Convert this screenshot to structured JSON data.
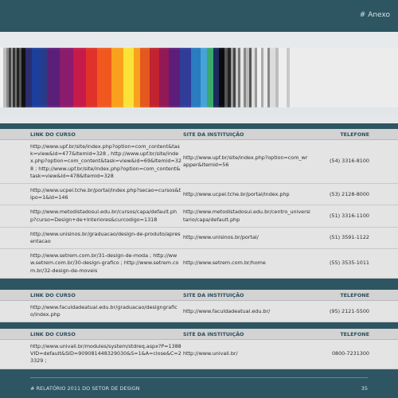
{
  "header": {
    "label": "# Anexo"
  },
  "tables": [
    {
      "headers": [
        "LINK DO CURSO",
        "SITE DA INSTITUIÇÃO",
        "TELEFONE"
      ],
      "rows": [
        [
          "http://www.upf.br/site/index.php?option=com_content&task=view&id=477&Itemid=328 , http://www.upf.br/site/index.php?option=com_content&task=view&id=69&Itemid=328 ; http://www.upf.br/site/index.php?option=com_content&task=view&id=478&Itemid=328",
          "http://www.upf.br/site/index.php?option=com_wrapper&Itemid=56",
          "(54) 3316-8100"
        ],
        [
          "http://www.ucpel.tche.br/portal/index.php?secao=cursos&tipo=1&id=146",
          "http://www.ucpel.tche.br/portal/index.php",
          "(53) 2128-8000"
        ],
        [
          "http://www.metodistadosul.edu.br/cursos/capa/default.php?curso=Design+de+Interiores&curcodigo=1318",
          "http://www.metodistadosul.edu.br/centro_universitario/capa/default.php",
          "(51) 3316-1100"
        ],
        [
          "http://www.unisinos.br/graduacao/design-de-produto/apresentacao",
          "http://www.unisinos.br/portal/",
          "(51) 3591-1122"
        ],
        [
          "http://www.setrem.com.br/31-design-de-moda ; http://www.setrem.com.br/30-design-grafico ; http://www.setrem.com.br/32-design-de-moveis",
          "http://www.setrem.com.br/home",
          "(55) 3535-1011"
        ]
      ]
    },
    {
      "headers": [
        "LINK DO CURSO",
        "SITE DA INSTITUIÇÃO",
        "TELEFONE"
      ],
      "rows": [
        [
          "http://www.faculdadeatual.edu.br/graduacao/designgrafico/index.php",
          "http://www.faculdadeatual.edu.br/",
          "(95) 2121-5500"
        ]
      ]
    },
    {
      "headers": [
        "LINK DO CURSO",
        "SITE DA INSTITUIÇÃO",
        "TELEFONE"
      ],
      "rows": [
        [
          "http://www.univali.br/modules/system/stdreq.aspx?P=1388VID=default&SID=909081448329030&S=1&A=close&C=23329 ;",
          "http://www.univali.br/",
          "0800-7231300"
        ]
      ]
    }
  ],
  "footer": {
    "left": "# RELATÓRIO 2011 DO SETOR DE DESIGN",
    "page": "35"
  }
}
